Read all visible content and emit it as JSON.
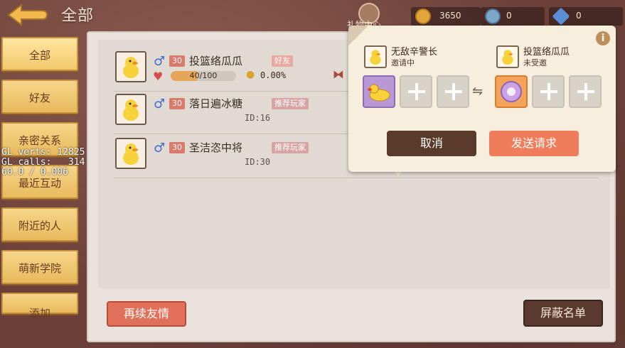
{
  "header": {
    "title": "全部",
    "gift_label": "礼物中心"
  },
  "resources": [
    {
      "icon": "gold-coin-icon",
      "value": "3650"
    },
    {
      "icon": "silver-coin-icon",
      "value": "0"
    },
    {
      "icon": "diamond-icon",
      "value": "0"
    }
  ],
  "sidebar": {
    "items": [
      {
        "label": "全部",
        "active": true
      },
      {
        "label": "好友"
      },
      {
        "label": "亲密关系"
      },
      {
        "label": "最近互动"
      },
      {
        "label": "附近的人"
      },
      {
        "label": "萌新学院"
      },
      {
        "label": "添加"
      }
    ]
  },
  "players": [
    {
      "level": "30",
      "name": "投篮络瓜瓜",
      "tag": "好友",
      "intimacy": "40/100",
      "intimacy_fraction": 0.4,
      "ratio": "0.00%"
    },
    {
      "level": "30",
      "name": "落日遍冰糖",
      "tag": "推荐玩家",
      "id": "ID:16"
    },
    {
      "level": "30",
      "name": "圣洁恣中将",
      "tag": "推荐玩家",
      "id": "ID:30"
    }
  ],
  "buttons": {
    "renew": "再续友情",
    "block_list": "屏蔽名单"
  },
  "popup": {
    "left_user": {
      "name": "无敌辛警长",
      "status": "邀请中"
    },
    "right_user": {
      "name": "投篮络瓜瓜",
      "status": "未受邀"
    },
    "swap_symbol": "⇋",
    "info": "i",
    "cancel": "取消",
    "send": "发送请求"
  },
  "debug": {
    "text": "GL verts: 12825\nGL calls:   314\n60.0 / 0.006"
  }
}
